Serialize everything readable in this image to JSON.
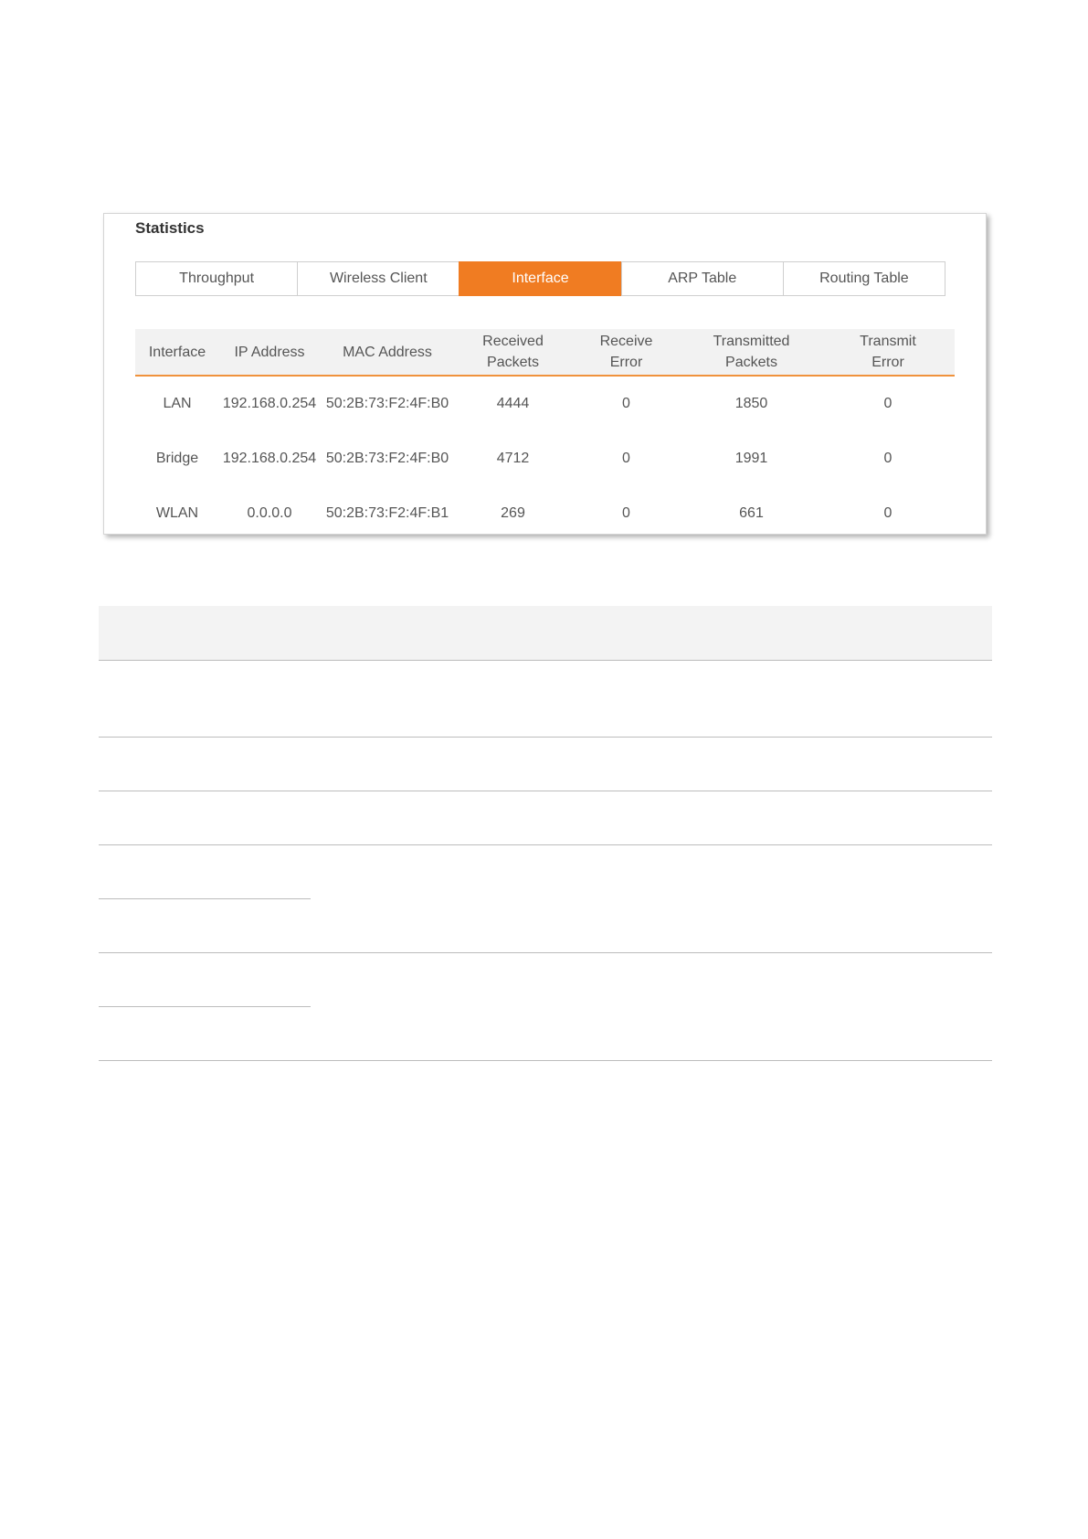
{
  "statistics": {
    "title": "Statistics",
    "tabs": [
      {
        "label": "Throughput",
        "active": false
      },
      {
        "label": "Wireless Client",
        "active": false
      },
      {
        "label": "Interface",
        "active": true
      },
      {
        "label": "ARP Table",
        "active": false
      },
      {
        "label": "Routing Table",
        "active": false
      }
    ],
    "table": {
      "headers": [
        "Interface",
        "IP Address",
        "MAC Address",
        "Received\nPackets",
        "Receive\nError",
        "Transmitted\nPackets",
        "Transmit\nError"
      ],
      "rows": [
        [
          "LAN",
          "192.168.0.254",
          "50:2B:73:F2:4F:B0",
          "4444",
          "0",
          "1850",
          "0"
        ],
        [
          "Bridge",
          "192.168.0.254",
          "50:2B:73:F2:4F:B0",
          "4712",
          "0",
          "1991",
          "0"
        ],
        [
          "WLAN",
          "0.0.0.0",
          "50:2B:73:F2:4F:B1",
          "269",
          "0",
          "661",
          "0"
        ]
      ]
    }
  },
  "colors": {
    "accent": "#f07c22",
    "header_underline": "#f0923c",
    "text": "#555555"
  }
}
